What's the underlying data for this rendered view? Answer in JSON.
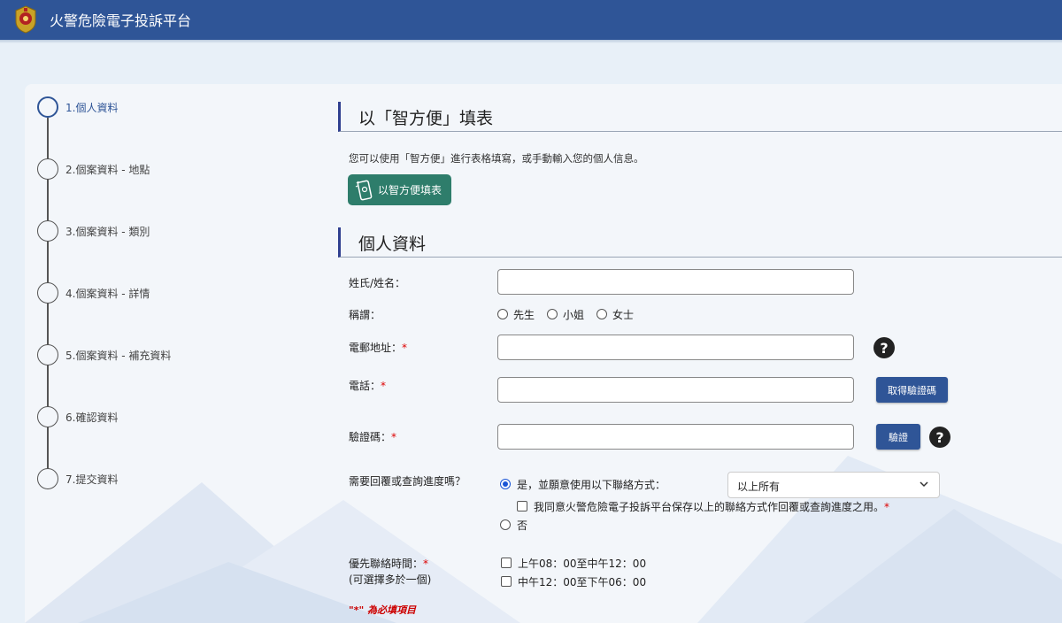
{
  "app": {
    "title": "火警危險電子投訴平台"
  },
  "steps": [
    {
      "label": "1.個人資料"
    },
    {
      "label": "2.個案資料 - 地點"
    },
    {
      "label": "3.個案資料 - 類別"
    },
    {
      "label": "4.個案資料 - 詳情"
    },
    {
      "label": "5.個案資料 - 補充資料"
    },
    {
      "label": "6.確認資料"
    },
    {
      "label": "7.提交資料"
    }
  ],
  "iamsmart": {
    "heading": "以「智方便」填表",
    "description": "您可以使用「智方便」進行表格填寫，或手動輸入您的個人信息。",
    "button_label": "以智方便填表"
  },
  "personal": {
    "heading": "個人資料",
    "name_label": "姓氏/姓名：",
    "title_label": "稱謂：",
    "title_options": [
      "先生",
      "小姐",
      "女士"
    ],
    "email_label": "電郵地址：",
    "phone_label": "電話：",
    "get_code_button": "取得驗證碼",
    "code_label": "驗證碼：",
    "verify_button": "驗證",
    "reply_label": "需要回覆或查詢進度嗎？",
    "reply_yes": "是，並願意使用以下聯絡方式：",
    "contact_method_selected": "以上所有",
    "consent_text": "我同意火警危險電子投訴平台保存以上的聯絡方式作回覆或查詢進度之用。",
    "reply_no": "否",
    "time_label": "優先聯絡時間：",
    "time_sublabel": "(可選擇多於一個)",
    "time_options": [
      "上午08：00至中午12：00",
      "中午12：00至下午06：00"
    ],
    "required_note": "\"*\" 為必填項目",
    "required_mark": "*"
  },
  "colors": {
    "header": "#2f5597",
    "iamsmart": "#2e7d6b",
    "required": "#dd0000"
  }
}
